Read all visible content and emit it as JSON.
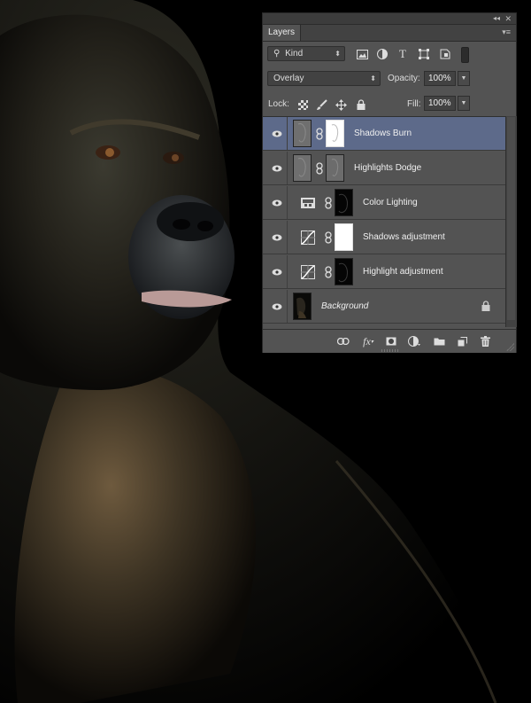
{
  "panel": {
    "tab_label": "Layers",
    "filter": {
      "kind_label": "Kind"
    },
    "blend_mode": "Overlay",
    "opacity_label": "Opacity:",
    "opacity_value": "100%",
    "lock_label": "Lock:",
    "fill_label": "Fill:",
    "fill_value": "100%",
    "layers": [
      {
        "name": "Shadows Burn",
        "selected": true,
        "type": "pixel-with-mask",
        "italic": false
      },
      {
        "name": "Highlights Dodge",
        "selected": false,
        "type": "pixel-with-mask",
        "italic": false
      },
      {
        "name": "Color Lighting",
        "selected": false,
        "type": "adjustment-gradient-map",
        "italic": false
      },
      {
        "name": "Shadows adjustment",
        "selected": false,
        "type": "adjustment-curves",
        "italic": false
      },
      {
        "name": "Highlight adjustment",
        "selected": false,
        "type": "adjustment-curves",
        "italic": false
      },
      {
        "name": "Background",
        "selected": false,
        "type": "background",
        "italic": true,
        "locked": true
      }
    ],
    "colors": {
      "panel_bg": "#535353",
      "selected_row": "#5d6a8a",
      "text": "#f0f0f0"
    }
  }
}
